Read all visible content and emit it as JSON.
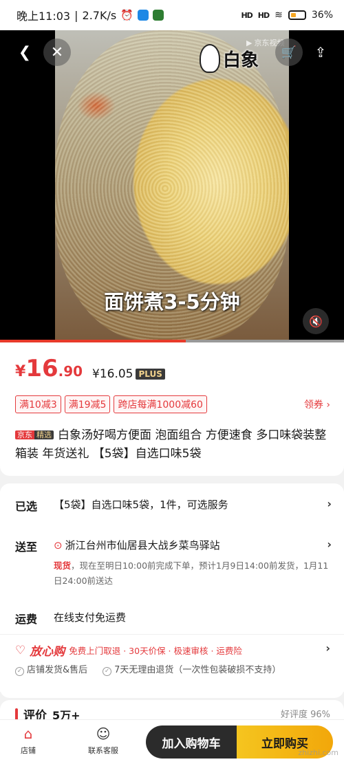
{
  "status_bar": {
    "time": "晚上11:03",
    "speed": "2.7K/s",
    "signal1": "HD",
    "signal2": "HD",
    "battery": "36%"
  },
  "media": {
    "brand": "白象",
    "platform_tag": "京东视频",
    "caption": "面饼煮3-5分钟",
    "progress": 0.54
  },
  "price": {
    "yen": "¥",
    "integer": "16",
    "decimal": ".90",
    "plus_price": "¥16.05",
    "plus_badge": "PLUS"
  },
  "coupons": [
    "满10减3",
    "满19减5",
    "跨店每满1000减60"
  ],
  "coupon_link": "领券 ›",
  "product": {
    "tag_a": "京东",
    "tag_b": "精选",
    "title": "白象汤好喝方便面 泡面组合 方便速食 多口味袋装整箱装  年货送礼 【5袋】自选口味5袋"
  },
  "info": {
    "selected_key": "已选",
    "selected_val": "【5袋】自选口味5袋，1件，可选服务",
    "ship_key": "送至",
    "ship_val": "浙江台州市仙居县大战乡菜鸟驿站",
    "delivery_hl": "现货",
    "delivery_text": "，现在至明日10:00前完成下单，预计1月9日14:00前发货，1月11日24:00前送达",
    "freight_key": "运费",
    "freight_val": "在线支付免运费"
  },
  "assure": {
    "logo": "放心购",
    "desc": "免费上门取退 · 30天价保 · 极速审核 · 运费险",
    "item1": "店铺发货&售后",
    "item2": "7天无理由退货（一次性包装破损不支持）"
  },
  "review": {
    "title": "评价",
    "count": "5万+",
    "good_rate": "好评度 96%"
  },
  "bottom": {
    "store": "店铺",
    "service": "联系客服",
    "add_cart": "加入购物车",
    "buy_now": "立即购买",
    "watermark": "zhizhi.com"
  }
}
